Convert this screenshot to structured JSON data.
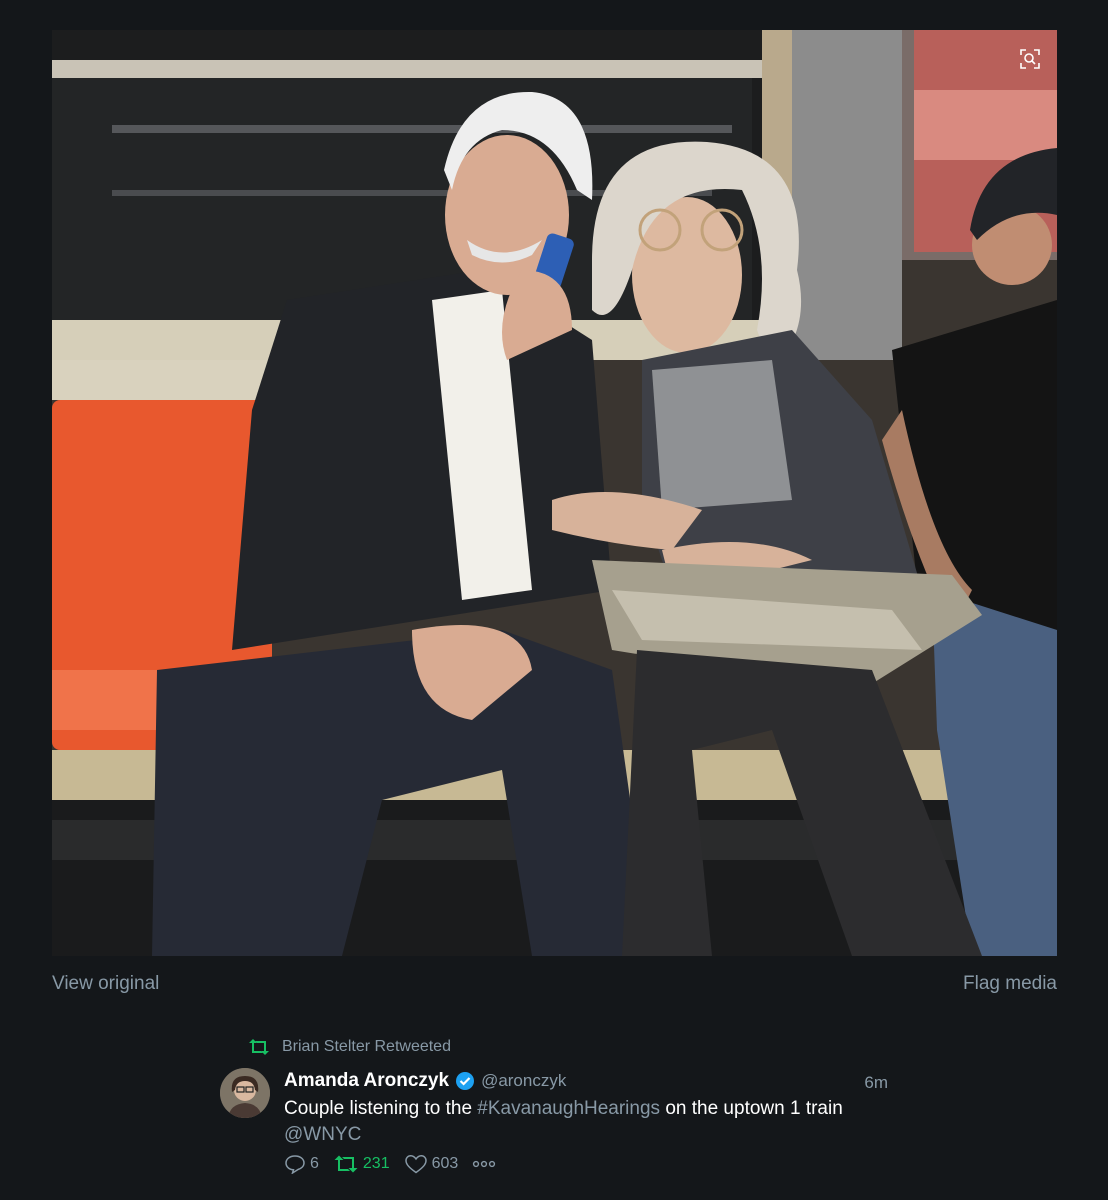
{
  "media": {
    "view_original_label": "View original",
    "flag_media_label": "Flag media"
  },
  "tweet": {
    "retweeted_by": "Brian Stelter Retweeted",
    "author_name": "Amanda Aronczyk",
    "author_handle": "@aronczyk",
    "time": "6m",
    "text_part1": "Couple listening to the ",
    "hashtag": "#KavanaughHearings",
    "text_part2": " on the uptown 1 train ",
    "mention": "@WNYC",
    "reply_count": "6",
    "retweet_count": "231",
    "like_count": "603"
  },
  "colors": {
    "background": "#14171a",
    "secondary_text": "#8899a6",
    "retweet_green": "#17bf63",
    "verified_blue": "#1da1f2"
  },
  "icons": [
    "zoom-icon",
    "retweet-icon",
    "verified-icon",
    "reply-icon",
    "like-icon",
    "more-icon"
  ]
}
